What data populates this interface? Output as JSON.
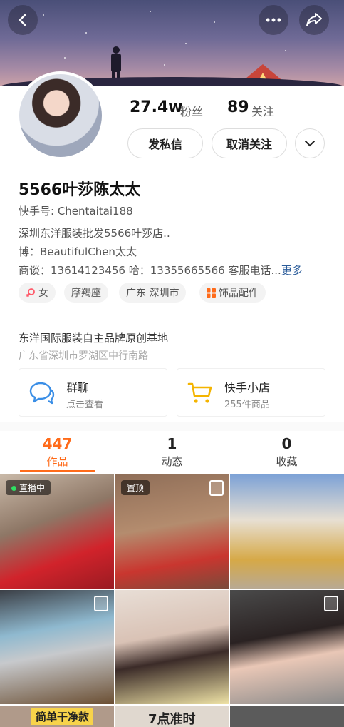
{
  "profile": {
    "fans_count": "27.4w",
    "fans_label": "粉丝",
    "following_count": "89",
    "following_label": "关注",
    "message_button": "发私信",
    "unfollow_button": "取消关注",
    "name": "5566叶莎陈太太",
    "user_id": "快手号: Chentaitai188",
    "bio_line1": "深圳东洋服装批发5566叶莎店..",
    "bio_line2": "博：BeautifulChen太太",
    "bio_line3": "商谈：13614123456 哈：13355665566 客服电话...",
    "more_link": "更多"
  },
  "tags": [
    {
      "icon": "female-icon",
      "label": "女"
    },
    {
      "icon": "",
      "label": "摩羯座"
    },
    {
      "icon": "",
      "label": "广东 深圳市"
    },
    {
      "icon": "grid-icon",
      "label": "饰品配件"
    }
  ],
  "business": {
    "title": "东洋国际服装自主品牌原创基地",
    "address": "广东省深圳市罗湖区中行南路"
  },
  "cards": {
    "group_chat": {
      "title": "群聊",
      "subtitle": "点击查看"
    },
    "shop": {
      "title": "快手小店",
      "subtitle": "255件商品"
    }
  },
  "tabs": [
    {
      "count": "447",
      "label": "作品"
    },
    {
      "count": "1",
      "label": "动态"
    },
    {
      "count": "0",
      "label": "收藏"
    }
  ],
  "grid": {
    "live_badge": "直播中",
    "pinned_badge": "置顶",
    "caption1": "简单干净款",
    "caption2": "7点准时"
  },
  "colors": {
    "accent": "#ff6b1a",
    "link": "#2b5c9a"
  }
}
